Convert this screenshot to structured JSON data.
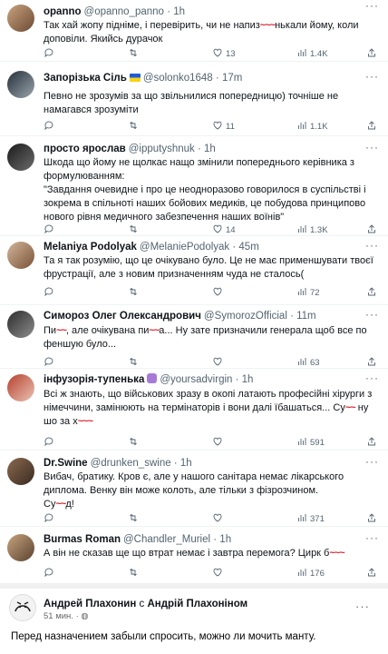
{
  "tweets": [
    {
      "name": "opanno",
      "handle": "@opanno_panno",
      "time": "1h",
      "body_a": "Так хай жопу підніме, і перевірить, чи не напиз",
      "body_redact": "~~~",
      "body_b": "нькали йому, коли доповіли. Якийсь дурачок",
      "reply": "",
      "retweet": "",
      "like": "13",
      "views": "1.4K",
      "colors": [
        "#c9a37e",
        "#6c4a34"
      ]
    },
    {
      "name": "Запорізька Сіль",
      "handle": "@solonko1648",
      "time": "17m",
      "body": "Певно не зрозумів за що звільнилися попередницю) точніше не намагався зрозуміти",
      "reply": "",
      "retweet": "",
      "like": "11",
      "views": "1.1K",
      "colors": [
        "#24303a",
        "#9aa4ad"
      ]
    },
    {
      "name": "просто ярослав",
      "handle": "@ipputyshnuk",
      "time": "1h",
      "body": "Шкода що йому не щолкає нащо змінили попереднього керівника з формулюванням:\n\"Завдання очевидне і про це неодноразово говорилося в суспільстві і зокрема в спільноті наших бойових медиків, це побудова принципово нового рівня медичного забезпечення наших воїнів\"",
      "reply": "",
      "retweet": "",
      "like": "14",
      "views": "1.3K",
      "colors": [
        "#1b1b1b",
        "#6b6b6b"
      ]
    },
    {
      "name": "Melaniya Podolyak",
      "handle": "@MelaniePodolyak",
      "time": "45m",
      "body": "Та я так розумію, що це очікувано було. Це не має применшувати твоєї фрустрації, але з новим призначенням чуда не сталось(",
      "reply": "",
      "retweet": "",
      "like": "",
      "views": "72",
      "colors": [
        "#d2b69a",
        "#7a5237"
      ]
    },
    {
      "name": "Симороз Олег Олександрович",
      "handle": "@SymorozOfficial",
      "time": "11m",
      "body_a": "Пи",
      "body_redact": "~~",
      "body_b": ", але очікувана пи",
      "body_redact2": "~~",
      "body_c": "а... Ну зате призначили генерала щоб все по феншую було...",
      "reply": "",
      "retweet": "",
      "like": "",
      "views": "63",
      "colors": [
        "#2c2c2c",
        "#8d8d8d"
      ]
    },
    {
      "name": "інфузорія-тупенька",
      "handle": "@yoursadvirgin",
      "time": "1h",
      "body_a": "Всі ж знають, що військових зразу в окопі латають професійні хірурги з німеччини, замінюють на термінаторів і вони далі їбашаться... Су",
      "body_redact": "~~",
      "body_b": " ну шо за х",
      "body_redact2": "~~~",
      "reply": "",
      "retweet": "",
      "like": "",
      "views": "591",
      "colors": [
        "#b7402f",
        "#e9c3b3"
      ]
    },
    {
      "name": "Dr.Swine",
      "handle": "@drunken_swine",
      "time": "1h",
      "body_a": "Вибач, братику. Кров є, але у нашого санітара немає лікарського диплома. Венку він може колоть, але тільки з фізрозчином.\nСу",
      "body_redact": "~~",
      "body_b": "д!",
      "reply": "",
      "retweet": "",
      "like": "",
      "views": "371",
      "colors": [
        "#8a6a50",
        "#3a2a20"
      ]
    },
    {
      "name": "Burmas Roman",
      "handle": "@Chandler_Muriel",
      "time": "1h",
      "body_a": "А він не сказав ще що втрат немає і завтра перемога? Цирк б",
      "body_redact": "~~~",
      "body_b": "",
      "reply": "",
      "retweet": "",
      "like": "",
      "views": "176",
      "colors": [
        "#c7a37d",
        "#5a4330"
      ]
    }
  ],
  "facebook": {
    "author": "Андрей Плахонин",
    "with_word": "с",
    "coauthor": "Андрій Плахоніном",
    "time": "51 мин.",
    "globe": "globe-icon",
    "body": "Перед назначением забыли спросить, можно ли мочить манту."
  }
}
